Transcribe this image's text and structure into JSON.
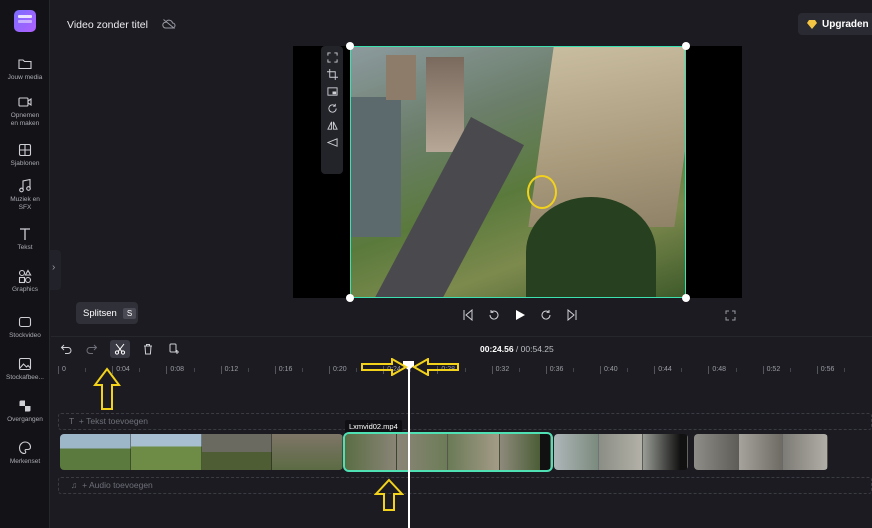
{
  "app": {
    "title": "Video zonder titel",
    "upgrade_label": "Upgraden"
  },
  "sidebar": {
    "items": [
      {
        "label": "Jouw media",
        "icon": "folder-icon"
      },
      {
        "label": "Opnemen en maken",
        "icon": "camera-icon"
      },
      {
        "label": "Sjablonen",
        "icon": "templates-icon"
      },
      {
        "label": "Muziek en SFX",
        "icon": "music-icon"
      },
      {
        "label": "Tekst",
        "icon": "text-icon"
      },
      {
        "label": "Graphics",
        "icon": "shapes-icon"
      },
      {
        "label": "Stockvideo",
        "icon": "stock-video-icon"
      },
      {
        "label": "Stockafbee...",
        "icon": "stock-image-icon"
      },
      {
        "label": "Overgangen",
        "icon": "transitions-icon"
      },
      {
        "label": "Merkenset",
        "icon": "brand-kit-icon"
      }
    ]
  },
  "tooltip": {
    "label": "Splitsen",
    "shortcut": "S"
  },
  "timeline": {
    "time_current": "00:24.56",
    "time_separator": " / ",
    "time_total": "00:54.25",
    "ruler_ticks": [
      "0",
      "0:04",
      "0:08",
      "0:12",
      "0:16",
      "0:20",
      "0:24",
      "0:28",
      "0:32",
      "0:36",
      "0:40",
      "0:44",
      "0:48",
      "0:52",
      "0:56"
    ],
    "text_track_label": "+ Tekst toevoegen",
    "audio_track_label": "+ Audio toevoegen",
    "selected_clip_name": "Lxmvid02.mp4"
  },
  "colors": {
    "accent_selection": "#3de0b0",
    "annotation_yellow": "#f2d21a"
  }
}
